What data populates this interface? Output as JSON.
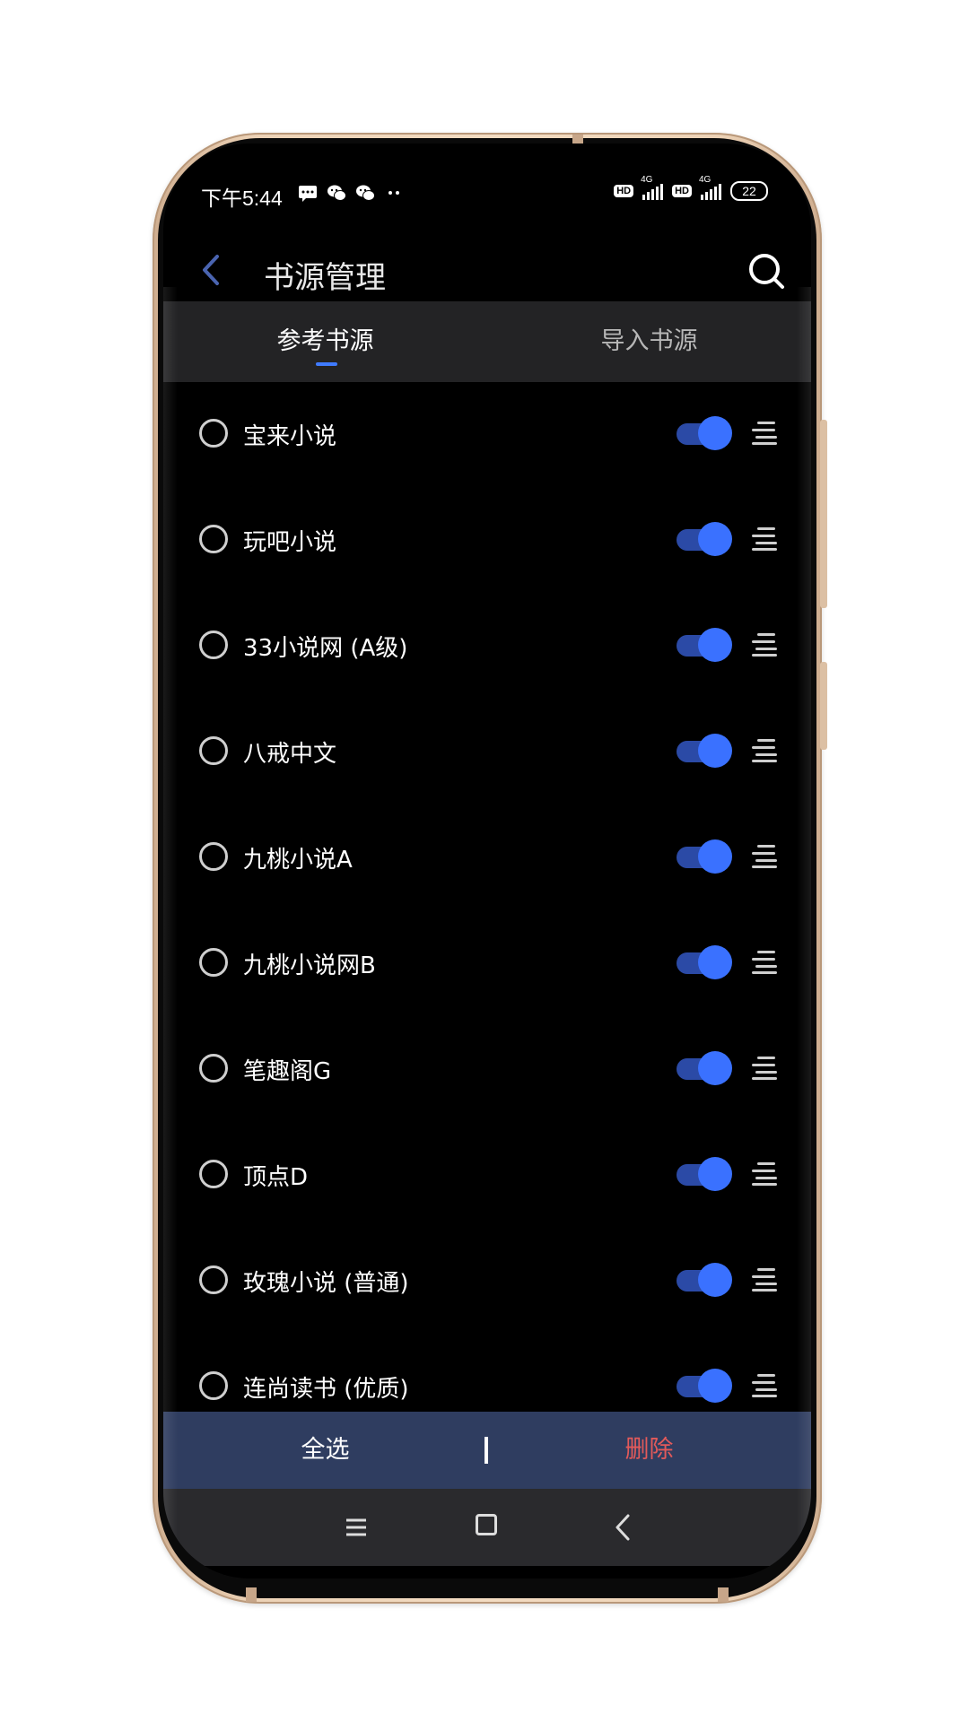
{
  "status_bar": {
    "time": "下午5:44",
    "network_label_1": "4G",
    "network_label_2": "4G",
    "hd_label_1": "HD",
    "hd_label_2": "HD",
    "battery": "22"
  },
  "header": {
    "title": "书源管理"
  },
  "tabs": [
    {
      "label": "参考书源",
      "active": true
    },
    {
      "label": "导入书源",
      "active": false
    }
  ],
  "sources": [
    {
      "name": "宝来小说",
      "enabled": true
    },
    {
      "name": "玩吧小说",
      "enabled": true
    },
    {
      "name": "33小说网 (A级)",
      "enabled": true
    },
    {
      "name": "八戒中文",
      "enabled": true
    },
    {
      "name": "九桃小说A",
      "enabled": true
    },
    {
      "name": "九桃小说网B",
      "enabled": true
    },
    {
      "name": "笔趣阁G",
      "enabled": true
    },
    {
      "name": "顶点D",
      "enabled": true
    },
    {
      "name": "玫瑰小说 (普通)",
      "enabled": true
    },
    {
      "name": "连尚读书 (优质)",
      "enabled": true
    }
  ],
  "actions": {
    "select_all": "全选",
    "delete": "删除"
  },
  "colors": {
    "accent": "#3a71ff",
    "toggle_track": "#2b4aa6",
    "action_bar": "#2f3d60",
    "delete": "#e35a5a"
  },
  "icons": {
    "back": "chevron-left-icon",
    "search": "search-icon",
    "drag": "drag-handle-icon",
    "nav_menu": "menu-icon",
    "nav_home": "home-square-icon",
    "nav_back": "back-icon"
  }
}
